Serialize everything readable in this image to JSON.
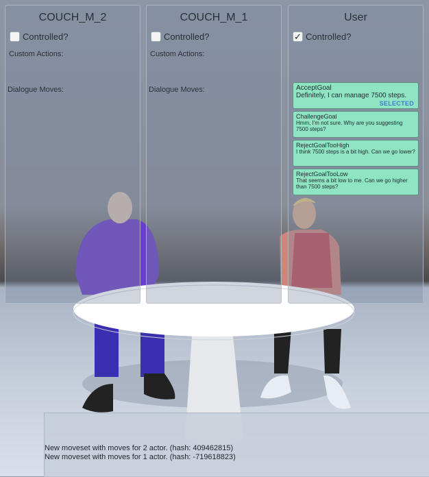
{
  "panels": [
    {
      "title": "COUCH_M_2",
      "controlled_label": "Controlled?",
      "controlled": false,
      "custom_actions_label": "Custom Actions:",
      "dialogue_moves_label": "Dialogue Moves:"
    },
    {
      "title": "COUCH_M_1",
      "controlled_label": "Controlled?",
      "controlled": false,
      "custom_actions_label": "Custom Actions:",
      "dialogue_moves_label": "Dialogue Moves:"
    },
    {
      "title": "User",
      "controlled_label": "Controlled?",
      "controlled": true,
      "moves": [
        {
          "name": "AcceptGoal",
          "text": "Definitely, I can manage 7500 steps.",
          "badge": "SELECTED"
        },
        {
          "name": "ChallengeGoal",
          "text_lines": [
            "Hmm, I'm not sure. Why are you suggesting",
            "7500 steps?"
          ]
        },
        {
          "name": "RejectGoalTooHigh",
          "text": "I think 7500 steps is a bit high. Can we go lower?"
        },
        {
          "name": "RejectGoalTooLow",
          "text_lines": [
            "That seems a bit low to me. Can we go higher",
            "than 7500 steps?"
          ]
        }
      ]
    }
  ],
  "log": {
    "lines": [
      "New moveset with moves for 2 actor. (hash: 409462815)",
      "New moveset with moves for 1 actor. (hash: -719618823)"
    ]
  },
  "colors": {
    "move_bg": "#8fe4c4",
    "selected": "#3f7fc9",
    "panel_bg": "rgba(120,135,160,0.35)"
  },
  "checkmark_icon": "✓"
}
